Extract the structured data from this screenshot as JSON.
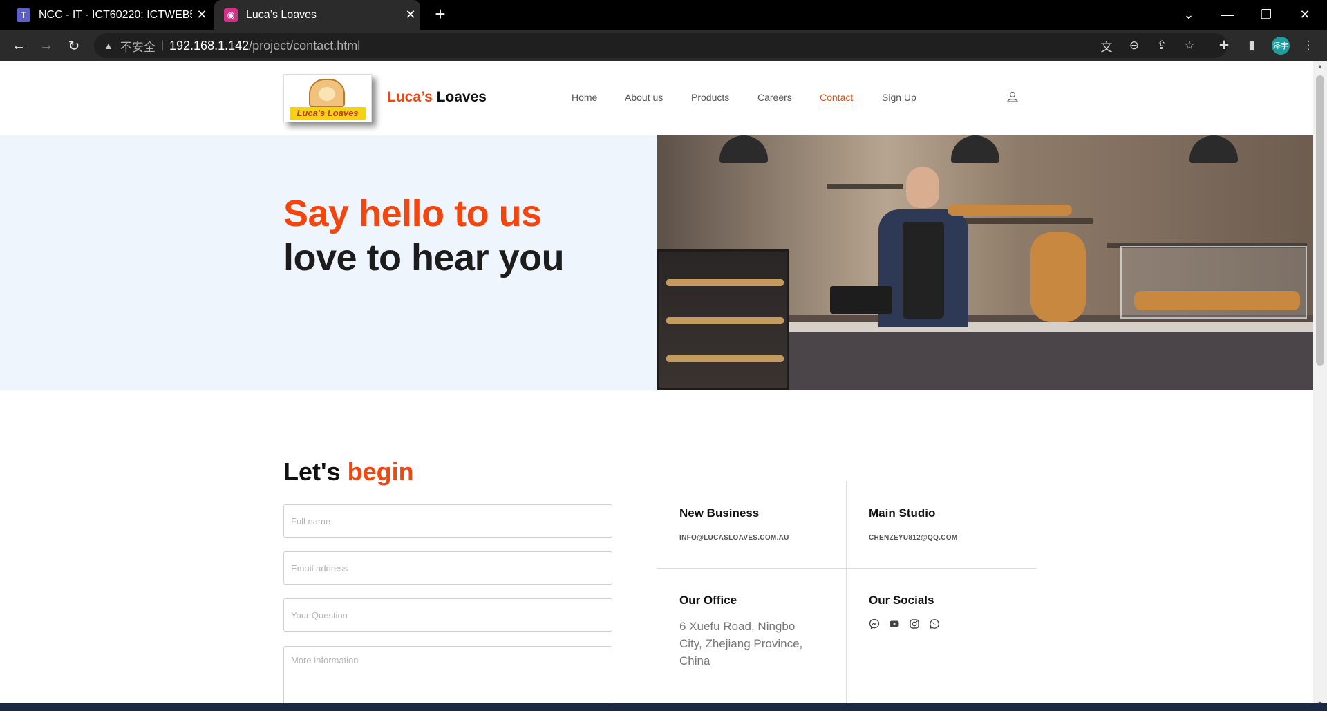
{
  "browser": {
    "tabs": [
      {
        "title": "NCC - IT - ICT60220: ICTWEB5",
        "active": false
      },
      {
        "title": "Luca’s Loaves",
        "active": true
      }
    ],
    "url": {
      "insecure_label": "不安全",
      "host": "192.168.1.142",
      "path": "/project/contact.html"
    },
    "profile_initials": "泽宇"
  },
  "site": {
    "brand_accent": "Luca’s",
    "brand_rest": " Loaves",
    "logo_text": "Luca's Loaves",
    "nav": [
      "Home",
      "About us",
      "Products",
      "Careers",
      "Contact",
      "Sign Up"
    ],
    "active_nav": "Contact",
    "accent_color": "#f2460f"
  },
  "hero": {
    "line1": "Say hello to us",
    "line2": "love to hear you"
  },
  "form": {
    "title_plain": "Let's",
    "title_accent": "begin",
    "placeholders": {
      "name": "Full name",
      "email": "Email address",
      "question": "Your Question",
      "more": "More information"
    }
  },
  "info": {
    "new_business": {
      "title": "New Business",
      "email": "INFO@LUCASLOAVES.COM.AU"
    },
    "main_studio": {
      "title": "Main Studio",
      "email": "CHENZEYU812@QQ.COM"
    },
    "office": {
      "title": "Our Office",
      "address": "6 Xuefu Road, Ningbo City, Zhejiang Province, China"
    },
    "socials": {
      "title": "Our Socials",
      "icons": [
        "messenger-icon",
        "youtube-icon",
        "instagram-icon",
        "whatsapp-icon"
      ]
    }
  }
}
